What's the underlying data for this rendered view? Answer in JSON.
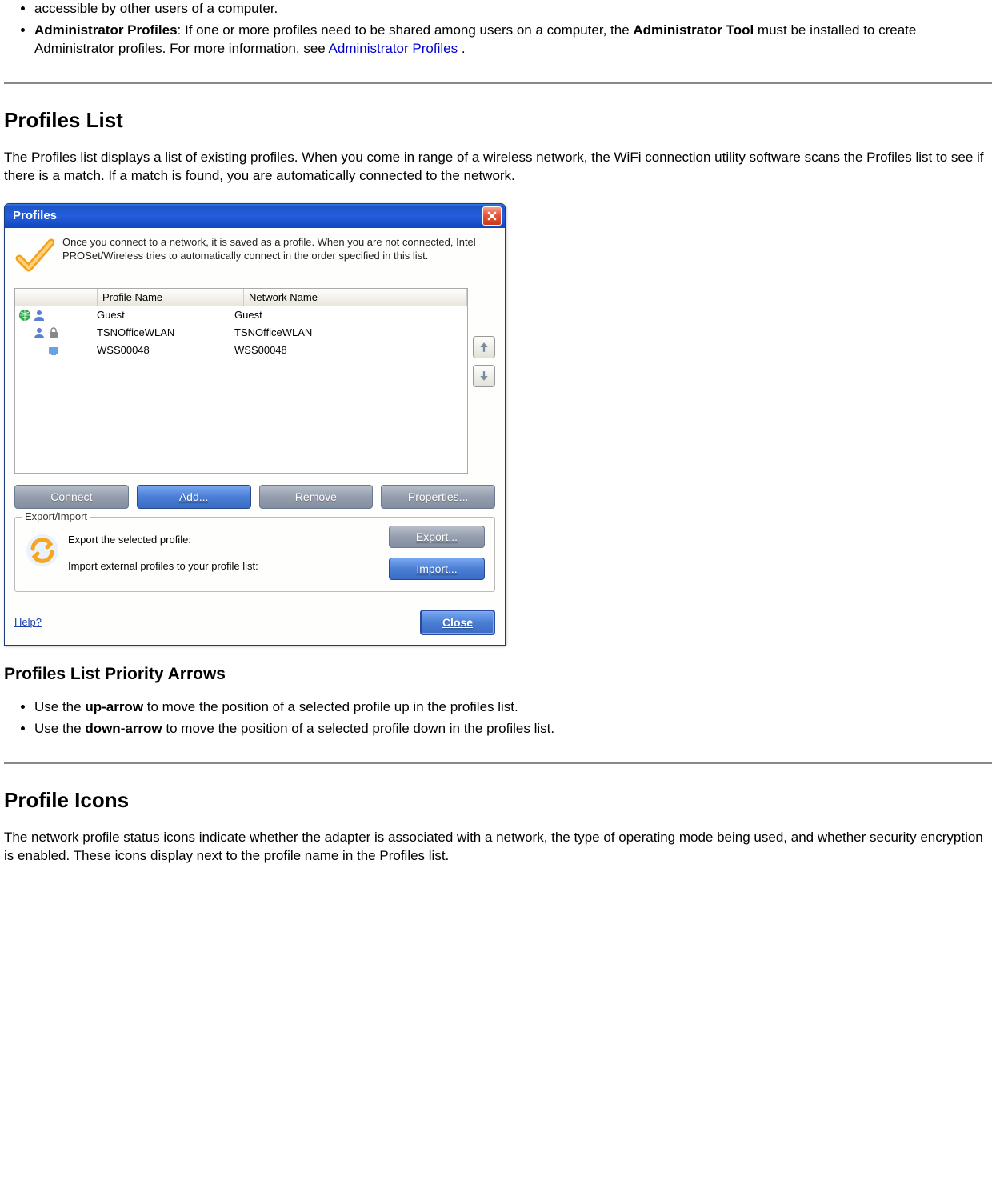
{
  "intro": {
    "partial_text": "accessible by other users of a computer.",
    "admin_bold": "Administrator Profiles",
    "admin_text_1": ": If one or more profiles need to be shared among users on a computer, the ",
    "admin_tool_bold": "Administrator Tool",
    "admin_text_2": " must be installed to create Administrator profiles. For more information, see ",
    "admin_link": "Administrator Profiles",
    "admin_text_3": " ."
  },
  "profiles_list": {
    "heading": "Profiles List",
    "description": "The Profiles list displays a list of existing profiles. When you come in range of a wireless network, the WiFi connection utility software scans the Profiles list to see if there is a match. If a match is found, you are automatically connected to the network."
  },
  "window": {
    "title": "Profiles",
    "intro": "Once you connect to a network, it is saved as a profile. When you are not connected, Intel PROSet/Wireless tries to automatically connect in the order specified in this list.",
    "columns": {
      "icons": "",
      "profile": "Profile Name",
      "network": "Network Name"
    },
    "rows": [
      {
        "profile": "Guest",
        "network": "Guest"
      },
      {
        "profile": "TSNOfficeWLAN",
        "network": "TSNOfficeWLAN"
      },
      {
        "profile": "WSS00048",
        "network": "WSS00048"
      }
    ],
    "buttons": {
      "connect": "Connect",
      "add": "Add...",
      "remove": "Remove",
      "properties": "Properties..."
    },
    "export_import": {
      "legend": "Export/Import",
      "export_text": "Export the selected profile:",
      "import_text": "Import external profiles to your profile list:",
      "export_btn": "Export...",
      "import_btn": "Import..."
    },
    "help": "Help?",
    "close": "Close"
  },
  "priority": {
    "heading": "Profiles List Priority Arrows",
    "up_pre": "Use the ",
    "up_bold": "up-arrow",
    "up_post": " to move the position of a selected profile up in the profiles list.",
    "down_pre": "Use the ",
    "down_bold": "down-arrow",
    "down_post": " to move the position of a selected profile down in the profiles list."
  },
  "icons_section": {
    "heading": "Profile Icons",
    "description": "The network profile status icons indicate whether the adapter is associated with a network, the type of operating mode being used, and whether security encryption is enabled. These icons display next to the profile name in the Profiles list."
  }
}
